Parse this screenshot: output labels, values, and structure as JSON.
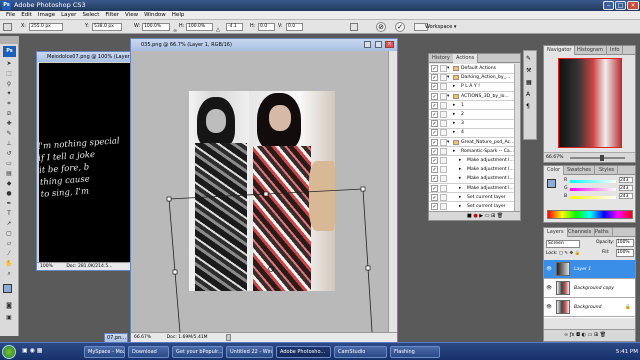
{
  "app": {
    "title": "Adobe Photoshop CS3",
    "logo": "Ps"
  },
  "menu": [
    "File",
    "Edit",
    "Image",
    "Layer",
    "Select",
    "Filter",
    "View",
    "Window",
    "Help"
  ],
  "options": {
    "x_label": "X:",
    "x_value": "255.0 px",
    "y_label": "Y:",
    "y_value": "538.0 px",
    "w_label": "W:",
    "w_value": "100.0%",
    "h_label": "H:",
    "h_value": "100.0%",
    "angle_value": "-4.1",
    "hskew_label": "H:",
    "hskew_value": "0.0",
    "vskew_label": "V:",
    "vskew_value": "0.0",
    "workspace": "Workspace ▾",
    "cancel_icon": "⊘",
    "commit_icon": "✓"
  },
  "doc_back": {
    "title": "Meiodolce07.png @ 100% (Layer 1...",
    "zoom": "100%",
    "status": "Doc: 281.0K/214.5..."
  },
  "doc_main": {
    "title": "035.png @ 66.7% (Layer 1, RGB/16)",
    "zoom": "66.67%",
    "status": "Doc: 1.69M/5.41M"
  },
  "doc_min": {
    "title": "07.pn..."
  },
  "handwriting": [
    "I'm nothing special",
    "if I tell a joke",
    "it be fore, b",
    "thing cause",
    "to sing, I'm"
  ],
  "actions_panel": {
    "tabs": [
      "History",
      "Actions"
    ],
    "rows": [
      {
        "label": "Default Actions",
        "indent": 1,
        "type": "folder",
        "checked": true
      },
      {
        "label": "Darking_Action_by_...",
        "indent": 1,
        "type": "folder",
        "checked": true
      },
      {
        "label": "P L A Y !",
        "indent": 2,
        "type": "action",
        "checked": true
      },
      {
        "label": "ACTIONS_3D_by_lo...",
        "indent": 1,
        "type": "folder",
        "checked": true
      },
      {
        "label": "1",
        "indent": 2,
        "type": "action",
        "checked": true
      },
      {
        "label": "2",
        "indent": 2,
        "type": "action",
        "checked": true
      },
      {
        "label": "3",
        "indent": 2,
        "type": "action",
        "checked": true
      },
      {
        "label": "4",
        "indent": 2,
        "type": "action",
        "checked": true
      },
      {
        "label": "Great_Nature_psd_Ac...",
        "indent": 1,
        "type": "folder",
        "checked": true
      },
      {
        "label": "Romantic-Spark -- Ca...",
        "indent": 2,
        "type": "action",
        "checked": true
      },
      {
        "label": "Make adjustment l...",
        "indent": 3,
        "type": "step",
        "checked": true
      },
      {
        "label": "Make adjustment l...",
        "indent": 3,
        "type": "step",
        "checked": true
      },
      {
        "label": "Make adjustment l...",
        "indent": 3,
        "type": "step",
        "checked": true
      },
      {
        "label": "Make adjustment l...",
        "indent": 3,
        "type": "step",
        "checked": true
      },
      {
        "label": "Set current layer",
        "indent": 3,
        "type": "step",
        "checked": true
      },
      {
        "label": "Set current layer",
        "indent": 3,
        "type": "step",
        "checked": true
      }
    ]
  },
  "navigator": {
    "tabs": [
      "Navigator",
      "Histogram",
      "Info"
    ],
    "zoom": "66.67%"
  },
  "color_panel": {
    "tabs": [
      "Color",
      "Swatches",
      "Styles"
    ],
    "sliders": [
      {
        "label": "R",
        "value": "243"
      },
      {
        "label": "G",
        "value": "243"
      },
      {
        "label": "B",
        "value": "243"
      }
    ],
    "foreground": "#8aaed8"
  },
  "layers_panel": {
    "tabs": [
      "Layers",
      "Channels",
      "Paths"
    ],
    "blend_mode": "Screen",
    "opacity_label": "Opacity:",
    "opacity": "100%",
    "fill_label": "Fill:",
    "fill": "100%",
    "layers": [
      {
        "name": "Layer 1",
        "selected": true
      },
      {
        "name": "Background copy",
        "selected": false
      },
      {
        "name": "Background",
        "selected": false
      }
    ]
  },
  "taskbar": {
    "items": [
      {
        "label": "MySpace - Mozill...",
        "active": false
      },
      {
        "label": "Download",
        "active": false
      },
      {
        "label": "Get your bPopulr...",
        "active": false
      },
      {
        "label": "Untitled 22 - Win...",
        "active": false
      },
      {
        "label": "Adobe Photosho...",
        "active": true
      },
      {
        "label": "CamStudio",
        "active": false
      },
      {
        "label": "Flashing",
        "active": false
      }
    ],
    "time": "5:41 PM"
  },
  "colors": {
    "title_bar": "#2b4a7c",
    "layer_selected": "#3a8ee8",
    "accent": "#1d5fb8"
  }
}
